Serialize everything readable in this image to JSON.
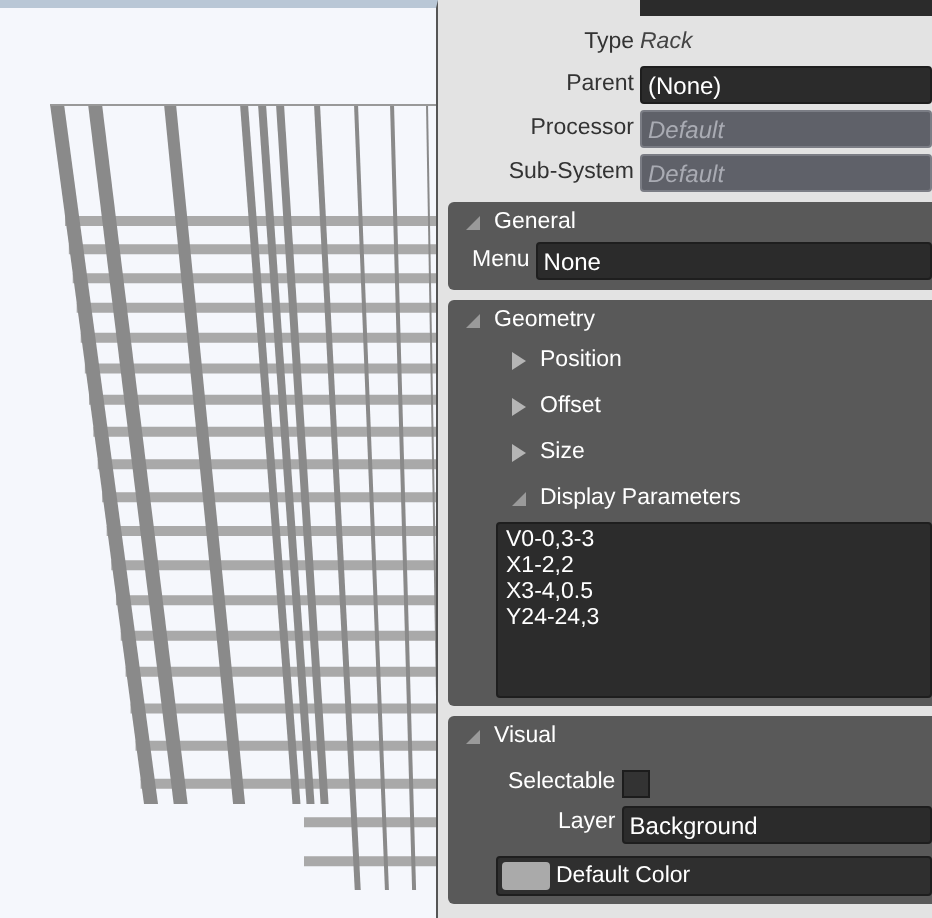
{
  "properties": [
    {
      "kind": "text",
      "label": "Type",
      "value": "Rack"
    },
    {
      "kind": "field",
      "label": "Parent",
      "value": "(None)",
      "disabled": false
    },
    {
      "kind": "field",
      "label": "Processor",
      "placeholder": "Default",
      "disabled": true
    },
    {
      "kind": "field",
      "label": "Sub-System",
      "placeholder": "Default",
      "disabled": true
    }
  ],
  "sections": [
    {
      "title": "General",
      "expanded": true,
      "rows": [
        {
          "kind": "field",
          "label": "Menu",
          "value": "None"
        }
      ]
    },
    {
      "title": "Geometry",
      "expanded": true,
      "rows": [
        {
          "kind": "group",
          "title": "Position",
          "expanded": false
        },
        {
          "kind": "group",
          "title": "Offset",
          "expanded": false
        },
        {
          "kind": "group",
          "title": "Size",
          "expanded": false
        },
        {
          "kind": "group",
          "title": "Display Parameters",
          "expanded": true,
          "lines": [
            "V0-0,3-3",
            "X1-2,2",
            "X3-4,0.5",
            "Y24-24,3"
          ]
        }
      ]
    },
    {
      "title": "Visual",
      "expanded": true,
      "rows": [
        {
          "kind": "checkbox",
          "label": "Selectable",
          "checked": false
        },
        {
          "kind": "field",
          "label": "Layer",
          "value": "Background"
        },
        {
          "kind": "color",
          "label": "Default Color"
        }
      ]
    }
  ]
}
